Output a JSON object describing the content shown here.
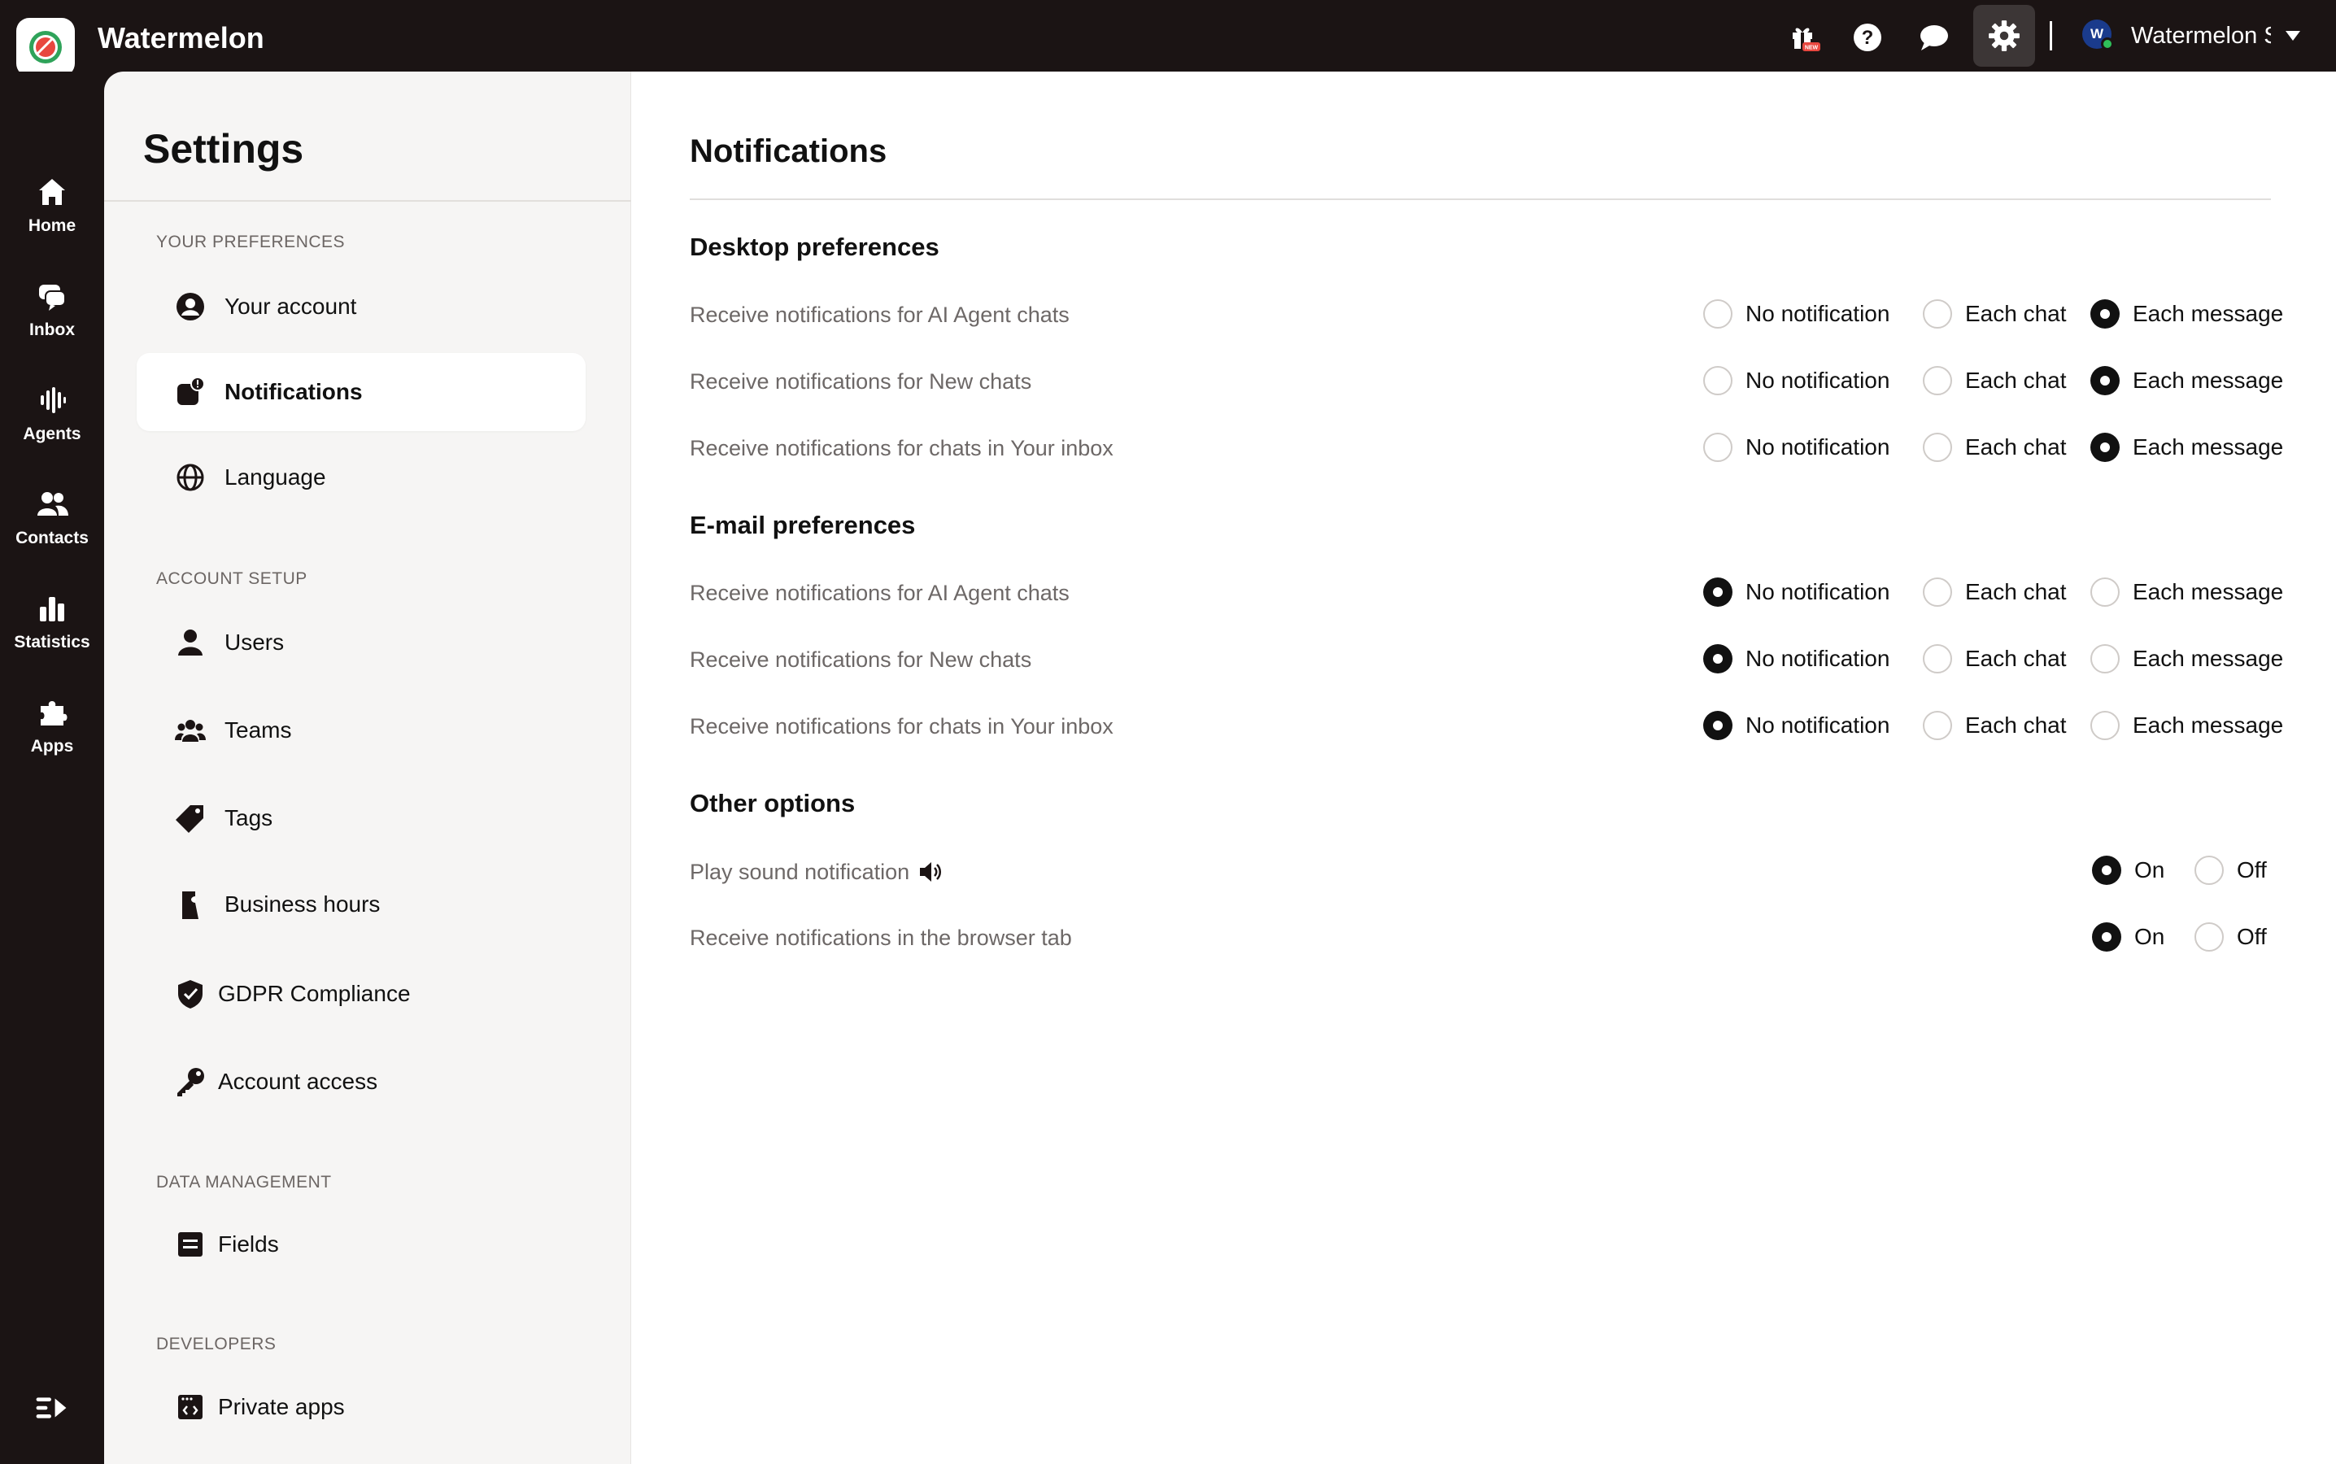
{
  "app": {
    "title": "Watermelon"
  },
  "header": {
    "account_name": "Watermelon S",
    "avatar_initial": "W",
    "icons": [
      "gift-new-icon",
      "help-icon",
      "chat-bubble-icon",
      "gear-icon"
    ]
  },
  "leftnav": {
    "items": [
      {
        "label": "Home",
        "icon": "home-icon"
      },
      {
        "label": "Inbox",
        "icon": "inbox-icon"
      },
      {
        "label": "Agents",
        "icon": "agents-icon"
      },
      {
        "label": "Contacts",
        "icon": "contacts-icon"
      },
      {
        "label": "Statistics",
        "icon": "statistics-icon"
      },
      {
        "label": "Apps",
        "icon": "apps-icon"
      }
    ]
  },
  "settings": {
    "title": "Settings",
    "sections": {
      "preferences": "YOUR PREFERENCES",
      "account_setup": "ACCOUNT SETUP",
      "data_management": "DATA MANAGEMENT",
      "developers": "DEVELOPERS"
    },
    "items": {
      "your_account": "Your account",
      "notifications": "Notifications",
      "language": "Language",
      "users": "Users",
      "teams": "Teams",
      "tags": "Tags",
      "business_hours": "Business hours",
      "gdpr": "GDPR Compliance",
      "account_access": "Account access",
      "fields": "Fields",
      "private_apps": "Private apps"
    }
  },
  "main": {
    "title": "Notifications",
    "desktop": {
      "title": "Desktop preferences",
      "rows": [
        {
          "label": "Receive notifications for AI Agent chats",
          "selected": "Each message"
        },
        {
          "label": "Receive notifications for New chats",
          "selected": "Each message"
        },
        {
          "label": "Receive notifications for chats in Your inbox",
          "selected": "Each message"
        }
      ]
    },
    "email": {
      "title": "E-mail preferences",
      "rows": [
        {
          "label": "Receive notifications for AI Agent chats",
          "selected": "No notification"
        },
        {
          "label": "Receive notifications for New chats",
          "selected": "No notification"
        },
        {
          "label": "Receive notifications for chats in Your inbox",
          "selected": "No notification"
        }
      ]
    },
    "options": [
      "No notification",
      "Each chat",
      "Each message"
    ],
    "other": {
      "title": "Other options",
      "rows": [
        {
          "label": "Play sound notification",
          "selected": "On"
        },
        {
          "label": "Receive notifications in the browser tab",
          "selected": "On"
        }
      ]
    },
    "on_off": [
      "On",
      "Off"
    ]
  }
}
